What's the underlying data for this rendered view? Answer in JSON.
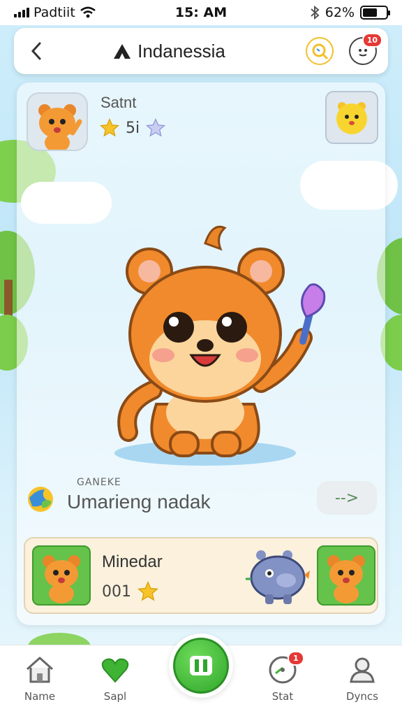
{
  "status_bar": {
    "carrier": "Padtiit",
    "time": "15: AM",
    "battery_percent": "62%",
    "battery_level": 0.62
  },
  "header": {
    "title": "Indanessia",
    "notification_badge": "10"
  },
  "profile": {
    "name": "Satnt",
    "rating": "5i"
  },
  "level": {
    "caption": "GANEKE",
    "name": "Umarieng nadak",
    "next_label": "-->"
  },
  "reward": {
    "title": "Minedar",
    "count": "001"
  },
  "nav": {
    "items": [
      {
        "label": "Name",
        "icon": "home-icon"
      },
      {
        "label": "Sapl",
        "icon": "heart-icon"
      },
      {
        "label": "Stat",
        "icon": "stats-icon",
        "badge": "1"
      },
      {
        "label": "Dyncs",
        "icon": "profile-icon"
      }
    ],
    "play_icon": "pause-icon"
  },
  "colors": {
    "accent_green": "#3fb333",
    "badge_red": "#e53935",
    "star_yellow": "#f6c329",
    "sky_blue": "#cfeefb"
  }
}
